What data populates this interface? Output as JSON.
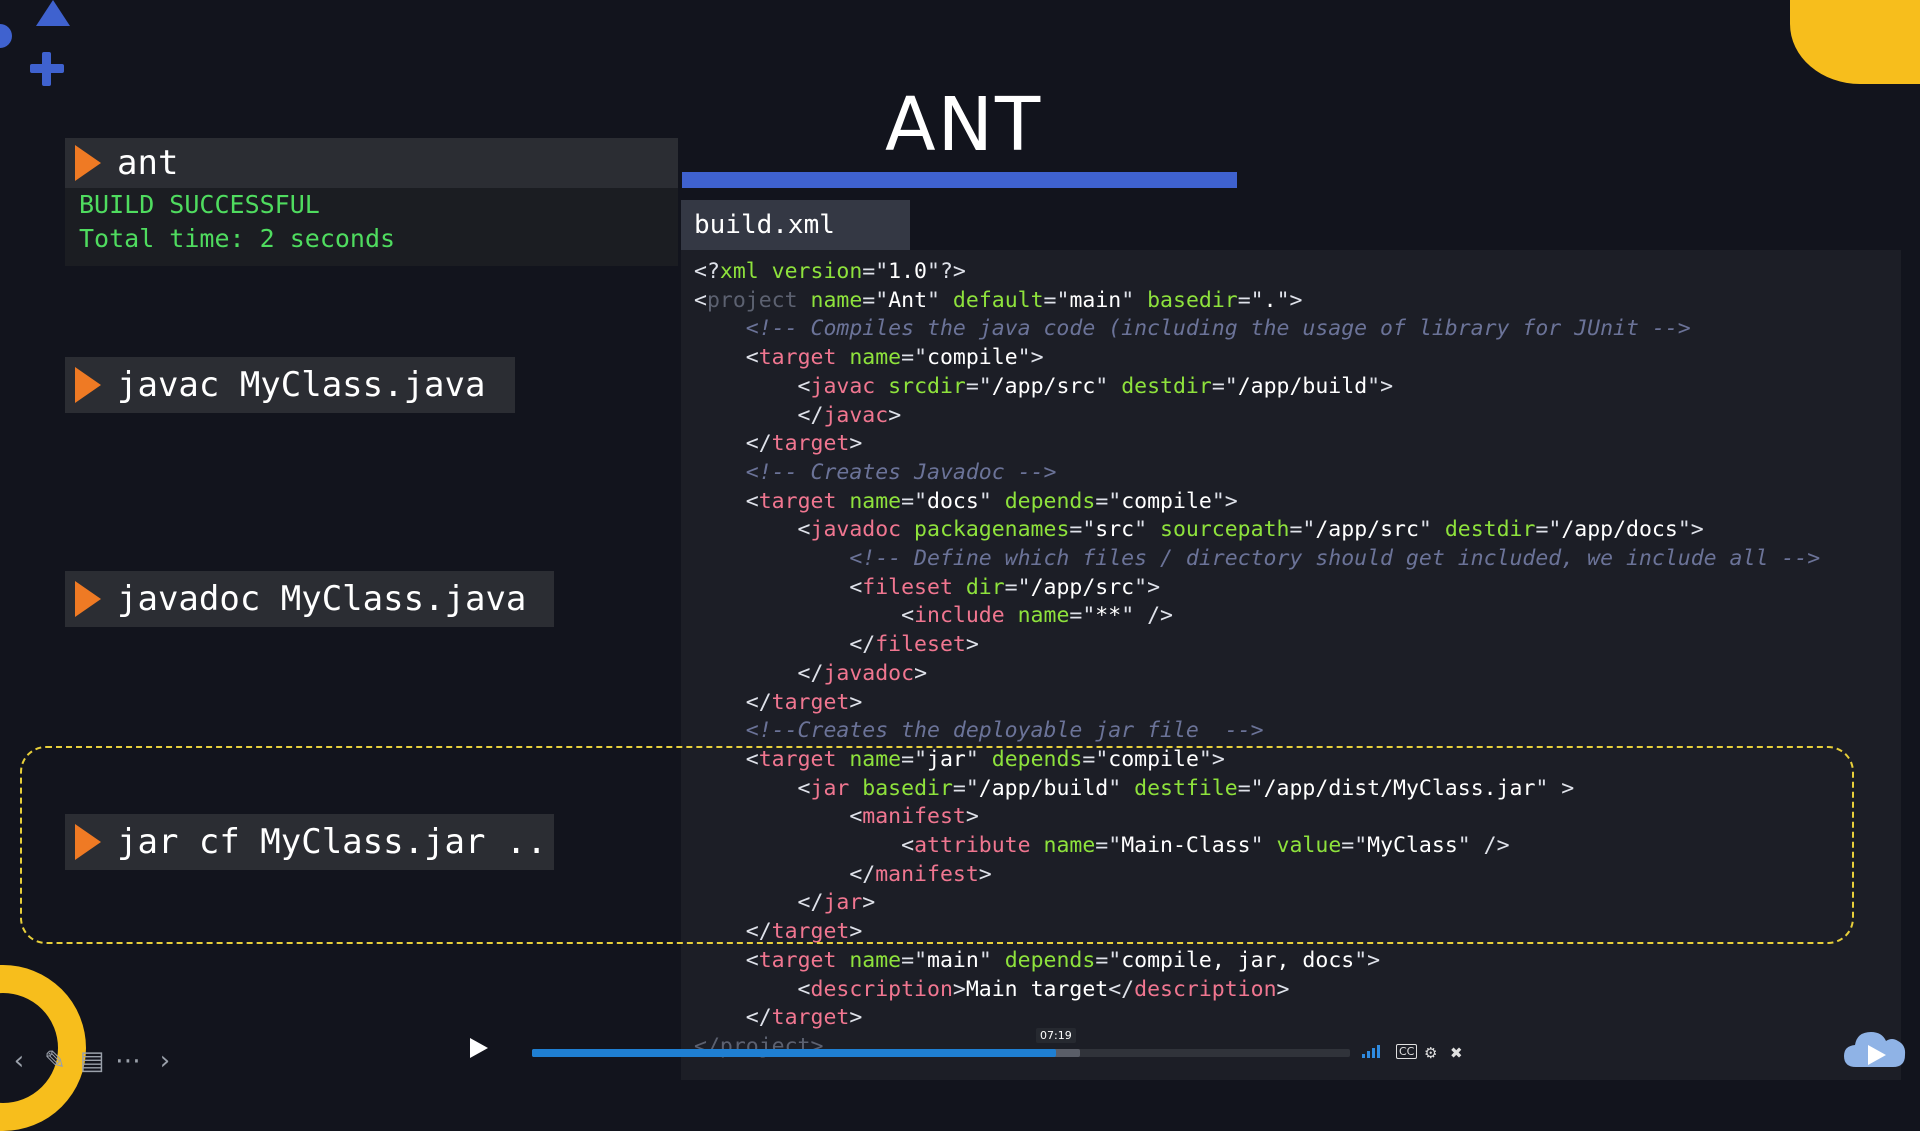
{
  "slide": {
    "title": "ANT"
  },
  "commands": {
    "ant": {
      "label": "ant",
      "output": [
        "BUILD SUCCESSFUL",
        "Total time: 2 seconds"
      ]
    },
    "javac": "javac MyClass.java",
    "javadoc": "javadoc MyClass.java",
    "jar": "jar cf MyClass.jar .."
  },
  "code": {
    "filename": "build.xml",
    "lines": [
      [
        [
          "p",
          "<?"
        ],
        [
          "tk-attr",
          "xml version"
        ],
        [
          "p",
          "=\""
        ],
        [
          "val",
          "1.0"
        ],
        [
          "p",
          "\"?>"
        ]
      ],
      [
        [
          "p",
          "<"
        ],
        [
          "dim",
          "project"
        ],
        [
          "attr",
          " name"
        ],
        [
          "p",
          "=\""
        ],
        [
          "val",
          "Ant"
        ],
        [
          "p",
          "\""
        ],
        [
          "attr",
          " default"
        ],
        [
          "p",
          "=\""
        ],
        [
          "val",
          "main"
        ],
        [
          "p",
          "\""
        ],
        [
          "attr",
          " basedir"
        ],
        [
          "p",
          "=\""
        ],
        [
          "val",
          "."
        ],
        [
          "p",
          "\">"
        ]
      ],
      [
        [
          "cmt",
          "    <!-- Compiles the java code (including the usage of library for JUnit -->"
        ]
      ],
      [
        [
          "p",
          "    <"
        ],
        [
          "tag",
          "target"
        ],
        [
          "attr",
          " name"
        ],
        [
          "p",
          "=\""
        ],
        [
          "val",
          "compile"
        ],
        [
          "p",
          "\">"
        ]
      ],
      [
        [
          "p",
          "        <"
        ],
        [
          "tag",
          "javac"
        ],
        [
          "attr",
          " srcdir"
        ],
        [
          "p",
          "=\""
        ],
        [
          "val",
          "/app/src"
        ],
        [
          "p",
          "\""
        ],
        [
          "attr",
          " destdir"
        ],
        [
          "p",
          "=\""
        ],
        [
          "val",
          "/app/build"
        ],
        [
          "p",
          "\">"
        ]
      ],
      [
        [
          "p",
          "        </"
        ],
        [
          "tag",
          "javac"
        ],
        [
          "p",
          ">"
        ]
      ],
      [
        [
          "p",
          "    </"
        ],
        [
          "tag",
          "target"
        ],
        [
          "p",
          ">"
        ]
      ],
      [
        [
          "cmt",
          "    <!-- Creates Javadoc -->"
        ]
      ],
      [
        [
          "p",
          "    <"
        ],
        [
          "tag",
          "target"
        ],
        [
          "attr",
          " name"
        ],
        [
          "p",
          "=\""
        ],
        [
          "val",
          "docs"
        ],
        [
          "p",
          "\""
        ],
        [
          "attr",
          " depends"
        ],
        [
          "p",
          "=\""
        ],
        [
          "val",
          "compile"
        ],
        [
          "p",
          "\">"
        ]
      ],
      [
        [
          "p",
          "        <"
        ],
        [
          "tag",
          "javadoc"
        ],
        [
          "attr",
          " packagenames"
        ],
        [
          "p",
          "=\""
        ],
        [
          "val",
          "src"
        ],
        [
          "p",
          "\""
        ],
        [
          "attr",
          " sourcepath"
        ],
        [
          "p",
          "=\""
        ],
        [
          "val",
          "/app/src"
        ],
        [
          "p",
          "\""
        ],
        [
          "attr",
          " destdir"
        ],
        [
          "p",
          "=\""
        ],
        [
          "val",
          "/app/docs"
        ],
        [
          "p",
          "\">"
        ]
      ],
      [
        [
          "cmt",
          "            <!-- Define which files / directory should get included, we include all -->"
        ]
      ],
      [
        [
          "p",
          "            <"
        ],
        [
          "tag",
          "fileset"
        ],
        [
          "attr",
          " dir"
        ],
        [
          "p",
          "=\""
        ],
        [
          "val",
          "/app/src"
        ],
        [
          "p",
          "\">"
        ]
      ],
      [
        [
          "p",
          "                <"
        ],
        [
          "tag",
          "include"
        ],
        [
          "attr",
          " name"
        ],
        [
          "p",
          "=\""
        ],
        [
          "val",
          "**"
        ],
        [
          "p",
          "\" />"
        ]
      ],
      [
        [
          "p",
          "            </"
        ],
        [
          "tag",
          "fileset"
        ],
        [
          "p",
          ">"
        ]
      ],
      [
        [
          "p",
          "        </"
        ],
        [
          "tag",
          "javadoc"
        ],
        [
          "p",
          ">"
        ]
      ],
      [
        [
          "p",
          "    </"
        ],
        [
          "tag",
          "target"
        ],
        [
          "p",
          ">"
        ]
      ],
      [
        [
          "cmt",
          "    <!--Creates the deployable jar file  -->"
        ]
      ],
      [
        [
          "p",
          "    <"
        ],
        [
          "tag",
          "target"
        ],
        [
          "attr",
          " name"
        ],
        [
          "p",
          "=\""
        ],
        [
          "val",
          "jar"
        ],
        [
          "p",
          "\""
        ],
        [
          "attr",
          " depends"
        ],
        [
          "p",
          "=\""
        ],
        [
          "val",
          "compile"
        ],
        [
          "p",
          "\">"
        ]
      ],
      [
        [
          "p",
          "        <"
        ],
        [
          "tag",
          "jar"
        ],
        [
          "attr",
          " basedir"
        ],
        [
          "p",
          "=\""
        ],
        [
          "val",
          "/app/build"
        ],
        [
          "p",
          "\""
        ],
        [
          "attr",
          " destfile"
        ],
        [
          "p",
          "=\""
        ],
        [
          "val",
          "/app/dist/MyClass.jar"
        ],
        [
          "p",
          "\" >"
        ]
      ],
      [
        [
          "p",
          "            <"
        ],
        [
          "tag",
          "manifest"
        ],
        [
          "p",
          ">"
        ]
      ],
      [
        [
          "p",
          "                <"
        ],
        [
          "tag",
          "attribute"
        ],
        [
          "attr",
          " name"
        ],
        [
          "p",
          "=\""
        ],
        [
          "val",
          "Main-Class"
        ],
        [
          "p",
          "\""
        ],
        [
          "attr",
          " value"
        ],
        [
          "p",
          "=\""
        ],
        [
          "val",
          "MyClass"
        ],
        [
          "p",
          "\" />"
        ]
      ],
      [
        [
          "p",
          "            </"
        ],
        [
          "tag",
          "manifest"
        ],
        [
          "p",
          ">"
        ]
      ],
      [
        [
          "p",
          "        </"
        ],
        [
          "tag",
          "jar"
        ],
        [
          "p",
          ">"
        ]
      ],
      [
        [
          "p",
          "    </"
        ],
        [
          "tag",
          "target"
        ],
        [
          "p",
          ">"
        ]
      ],
      [
        [
          "p",
          "    <"
        ],
        [
          "tag",
          "target"
        ],
        [
          "attr",
          " name"
        ],
        [
          "p",
          "=\""
        ],
        [
          "val",
          "main"
        ],
        [
          "p",
          "\""
        ],
        [
          "attr",
          " depends"
        ],
        [
          "p",
          "=\""
        ],
        [
          "val",
          "compile, jar, docs"
        ],
        [
          "p",
          "\">"
        ]
      ],
      [
        [
          "p",
          "        <"
        ],
        [
          "tag",
          "description"
        ],
        [
          "p",
          ">"
        ],
        [
          "txt",
          "Main target"
        ],
        [
          "p",
          "</"
        ],
        [
          "tag",
          "description"
        ],
        [
          "p",
          ">"
        ]
      ],
      [
        [
          "p",
          "    </"
        ],
        [
          "tag",
          "target"
        ],
        [
          "p",
          ">"
        ]
      ],
      [
        [
          "dim",
          "</project>"
        ]
      ]
    ]
  },
  "player": {
    "time_tooltip": "07:19",
    "progress_fraction": 0.64,
    "buffered_fraction": 0.67,
    "cc_label": "CC"
  },
  "colors": {
    "accent_blue": "#3f62cf",
    "accent_yellow": "#f7be1c",
    "accent_orange": "#ef7a24",
    "build_green": "#4fdc5f",
    "highlight_dash": "#e7cf3a"
  },
  "icons": {
    "nav": [
      "arrow-left-icon",
      "pencil-icon",
      "captions-icon",
      "more-icon",
      "arrow-right-icon"
    ],
    "player": [
      "play-icon",
      "signal-icon",
      "cc-icon",
      "gear-icon",
      "fullscreen-icon"
    ],
    "brand": "cloud-play-icon"
  }
}
